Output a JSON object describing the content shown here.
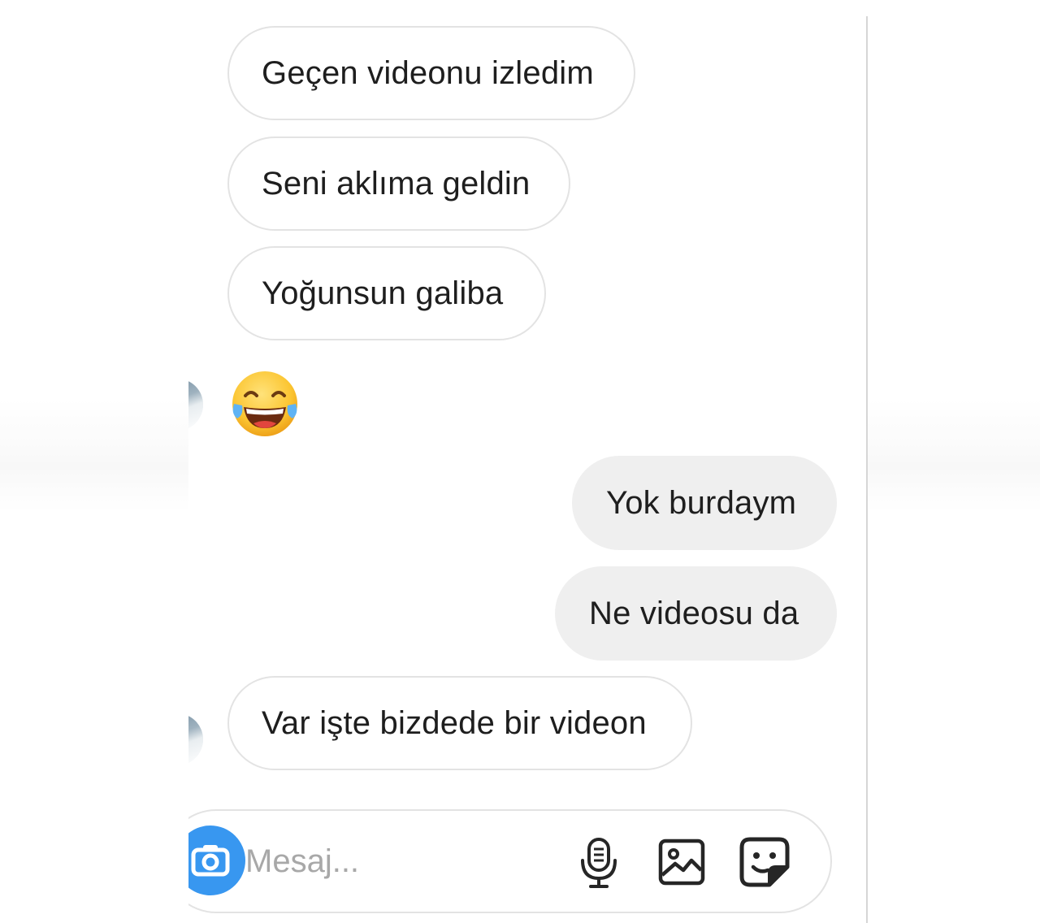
{
  "conversation": {
    "messages": [
      {
        "text": "Geçen videonu izledim",
        "direction": "incoming"
      },
      {
        "text": "Seni aklıma geldin",
        "direction": "incoming"
      },
      {
        "text": "Yoğunsun galiba",
        "direction": "incoming"
      },
      {
        "text": "😂",
        "direction": "incoming",
        "kind": "emoji",
        "icon": "face-with-tears-of-joy-icon"
      },
      {
        "text": "Yok burdaym",
        "direction": "outgoing"
      },
      {
        "text": "Ne videosu da",
        "direction": "outgoing"
      },
      {
        "text": "Var işte bizdede bir videon",
        "direction": "incoming"
      }
    ]
  },
  "composer": {
    "placeholder": "Mesaj...",
    "value": "",
    "buttons": [
      "camera-icon",
      "microphone-icon",
      "gallery-icon",
      "sticker-icon"
    ],
    "accent_color": "#3897f0"
  },
  "colors": {
    "incoming_bubble": "#ffffff",
    "outgoing_bubble": "#efefef",
    "bubble_border": "#e3e3e3",
    "text": "#1e1e1e"
  }
}
